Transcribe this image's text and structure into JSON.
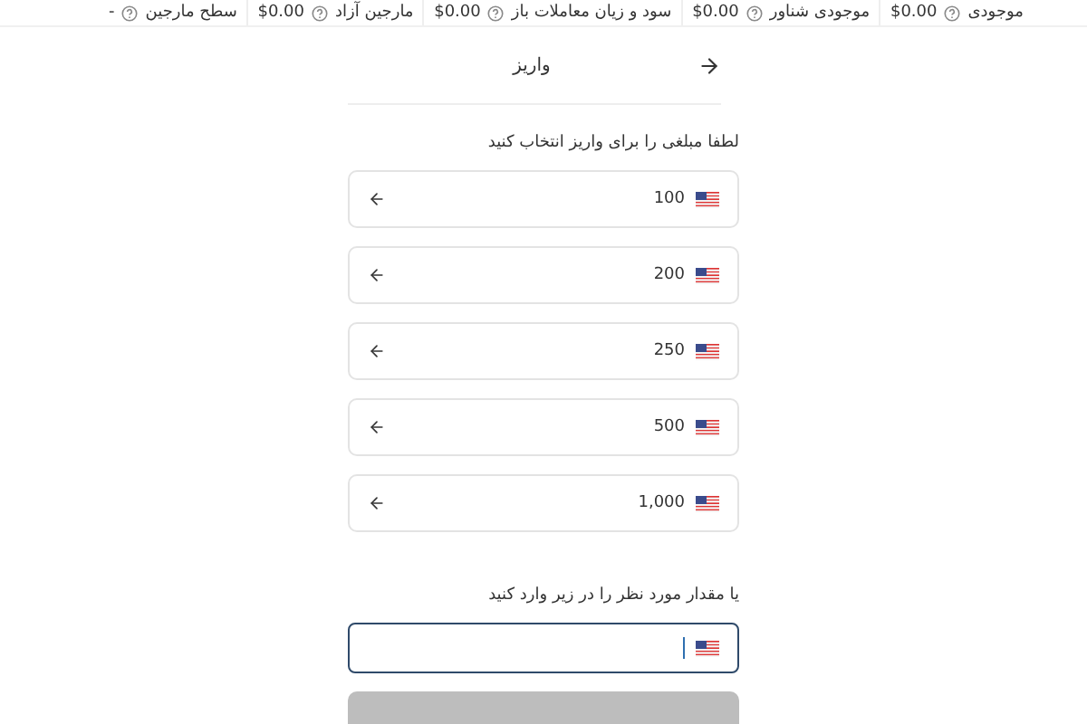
{
  "stats": [
    {
      "label": "موجودی",
      "value": "$0.00"
    },
    {
      "label": "موجودی شناور",
      "value": "$0.00"
    },
    {
      "label": "سود و زیان معاملات باز",
      "value": "$0.00"
    },
    {
      "label": "مارجین آزاد",
      "value": "$0.00"
    },
    {
      "label": "سطح مارجین",
      "value": "-"
    }
  ],
  "header": {
    "title": "واریز"
  },
  "prompt": "لطفا مبلغی را برای واریز انتخاب کنید",
  "amounts": [
    "100",
    "200",
    "250",
    "500",
    "1,000"
  ],
  "custom": {
    "label": "یا مقدار مورد نظر را در زیر وارد کنید"
  },
  "submit": {
    "disabled": true
  }
}
